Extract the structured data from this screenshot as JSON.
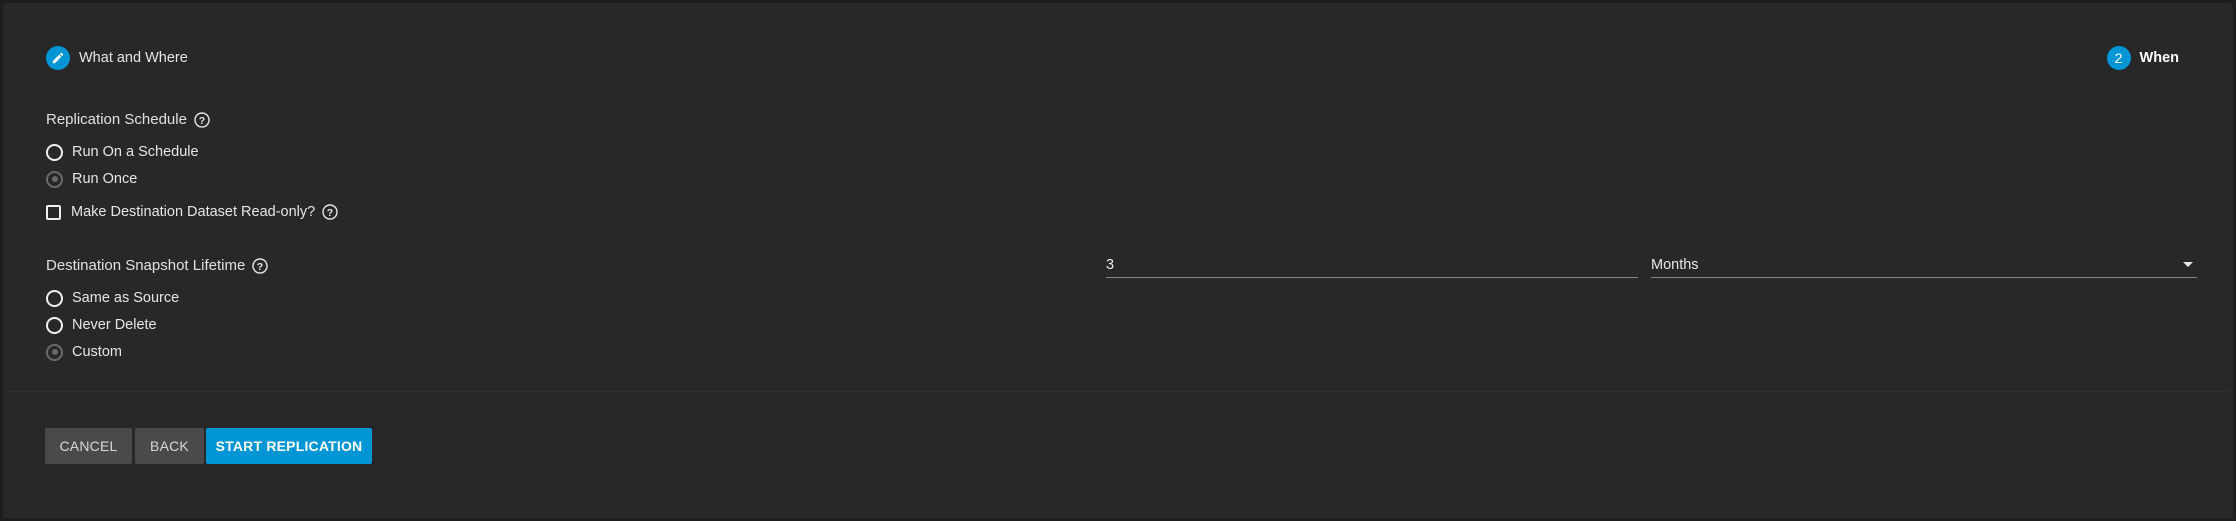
{
  "stepper": {
    "step1": {
      "label": "What and Where",
      "icon": "pencil-icon"
    },
    "step2": {
      "number": "2",
      "label": "When"
    }
  },
  "replication_schedule": {
    "label": "Replication Schedule",
    "options": [
      {
        "label": "Run On a Schedule",
        "selected": false
      },
      {
        "label": "Run Once",
        "selected": true
      }
    ]
  },
  "readonly_checkbox": {
    "label": "Make Destination Dataset Read-only?",
    "checked": false
  },
  "snapshot_lifetime": {
    "label": "Destination Snapshot Lifetime",
    "options": [
      {
        "label": "Same as Source",
        "selected": false
      },
      {
        "label": "Never Delete",
        "selected": false
      },
      {
        "label": "Custom",
        "selected": true
      }
    ],
    "value": "3",
    "unit": "Months"
  },
  "buttons": {
    "cancel": "CANCEL",
    "back": "BACK",
    "start": "START REPLICATION"
  },
  "colors": {
    "accent": "#0095d5",
    "background": "#282828",
    "button_secondary": "#4a4a4a"
  }
}
